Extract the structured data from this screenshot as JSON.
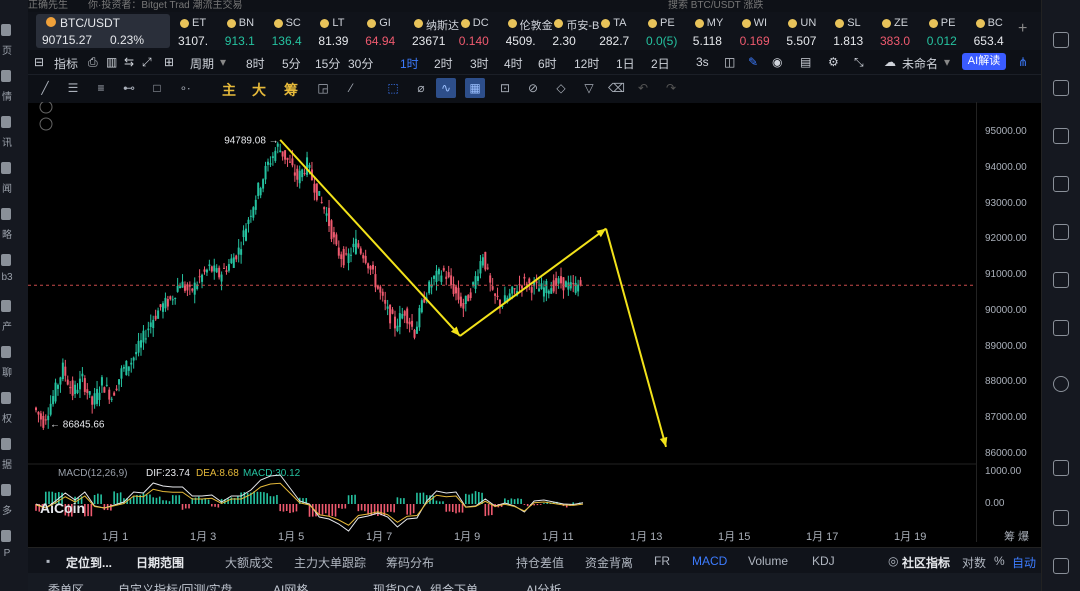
{
  "top": {
    "app_title": "正确先生",
    "marquee": "你·投资者：Bitget Trad 潮流主交易",
    "search_placeholder": "搜索 BTC/USDT 涨跌"
  },
  "left_nav": [
    "页",
    "情",
    "讯",
    "闻",
    "略",
    "b3",
    "产",
    "聊",
    "权",
    "据",
    "多",
    "P"
  ],
  "tickers": {
    "selected": {
      "name": "BTC/USDT",
      "price": "90715.27",
      "change": "0.23%"
    },
    "items": [
      {
        "name": "ET",
        "value": "3107.",
        "dir": "wh"
      },
      {
        "name": "BN",
        "value": "913.1",
        "dir": "up"
      },
      {
        "name": "SC",
        "value": "136.4",
        "dir": "up"
      },
      {
        "name": "LT",
        "value": "81.39",
        "dir": "wh"
      },
      {
        "name": "GI",
        "value": "64.94",
        "dir": "dn"
      },
      {
        "name": "纳斯达",
        "value": "23671",
        "dir": "wh"
      },
      {
        "name": "DC",
        "value": "0.140",
        "dir": "dn"
      },
      {
        "name": "伦敦金",
        "value": "4509.",
        "dir": "wh"
      },
      {
        "name": "币安-B",
        "value": "2.30",
        "dir": "wh"
      },
      {
        "name": "TA",
        "value": "282.7",
        "dir": "wh"
      },
      {
        "name": "PE",
        "value": "0.0(5)",
        "dir": "up"
      },
      {
        "name": "MY",
        "value": "5.118",
        "dir": "wh"
      },
      {
        "name": "WI",
        "value": "0.169",
        "dir": "dn"
      },
      {
        "name": "UN",
        "value": "5.507",
        "dir": "wh"
      },
      {
        "name": "SL",
        "value": "1.813",
        "dir": "wh"
      },
      {
        "name": "ZE",
        "value": "383.0",
        "dir": "dn"
      },
      {
        "name": "PE",
        "value": "0.012",
        "dir": "up"
      },
      {
        "name": "BC",
        "value": "653.4",
        "dir": "wh"
      }
    ]
  },
  "toolbar1": {
    "indicator": "指标",
    "period": "周期",
    "intervals": [
      "8时",
      "5分",
      "15分",
      "30分",
      "1时",
      "2时",
      "3时",
      "4时",
      "6时",
      "12时",
      "1日",
      "2日"
    ],
    "active_interval": "1时",
    "secs": "3s",
    "unnamed": "未命名",
    "ai_btn": "AI解读"
  },
  "toolbar2": {
    "zhu": "主",
    "da": "大",
    "chou": "筹"
  },
  "chart_data": {
    "type": "candlestick",
    "symbol": "BTC/USDT",
    "interval": "1h",
    "annotations": {
      "high_label": "94789.08",
      "low_label": "86845.66"
    },
    "current_price_line": 90715.27,
    "price_axis": [
      "95000.00",
      "94000.00",
      "93000.00",
      "92000.00",
      "91000.00",
      "90000.00",
      "89000.00",
      "88000.00",
      "87000.00",
      "86000.00"
    ],
    "ylim": [
      86000,
      95000
    ],
    "x_ticks": [
      "1月 1",
      "1月 3",
      "1月 5",
      "1月 7",
      "1月 9",
      "1月 11",
      "1月 13",
      "1月 15",
      "1月 17",
      "1月 19"
    ],
    "close_path": [
      87300,
      86900,
      87600,
      88400,
      87700,
      88100,
      87400,
      88000,
      87600,
      88300,
      88600,
      89100,
      89700,
      90100,
      90300,
      90800,
      90500,
      90900,
      91200,
      91000,
      91300,
      91700,
      92600,
      93400,
      94100,
      94600,
      94200,
      93700,
      94100,
      93300,
      92700,
      91700,
      91400,
      91900,
      91500,
      90800,
      90100,
      89600,
      90000,
      89400,
      90400,
      90900,
      91100,
      90600,
      90100,
      90700,
      91600,
      90400,
      90200,
      90500,
      90800,
      90700,
      90600,
      90700,
      90800,
      90650,
      90720
    ],
    "macd": {
      "label": "MACD(12,26,9)",
      "dif": "23.74",
      "dea": "8.68",
      "macd": "30.12",
      "axis": [
        "1000.00",
        "0.00"
      ]
    },
    "drawn_arrows": "yellow trend arrows"
  },
  "x_end_label": "筹 爆",
  "watermark": "AiCoin",
  "bottom_tabs": {
    "items": [
      {
        "label": "定位到...",
        "style": "bold"
      },
      {
        "label": "日期范围",
        "style": "bold"
      },
      {
        "label": "大额成交",
        "style": ""
      },
      {
        "label": "主力大单跟踪",
        "style": ""
      },
      {
        "label": "筹码分布",
        "style": ""
      },
      {
        "label": "持仓差值",
        "style": ""
      },
      {
        "label": "资金背离",
        "style": ""
      },
      {
        "label": "FR",
        "style": ""
      },
      {
        "label": "MACD",
        "style": "active"
      },
      {
        "label": "Volume",
        "style": ""
      },
      {
        "label": "KDJ",
        "style": ""
      },
      {
        "label": "社区指标",
        "style": "bold"
      },
      {
        "label": "对数",
        "style": ""
      },
      {
        "label": "%",
        "style": ""
      },
      {
        "label": "自动",
        "style": "active"
      }
    ]
  },
  "bottom_tabs2": [
    "委单区",
    "自定义指标/回测/实盘",
    "AI网格",
    "现货DCA",
    "组合下单",
    "AI分析"
  ]
}
